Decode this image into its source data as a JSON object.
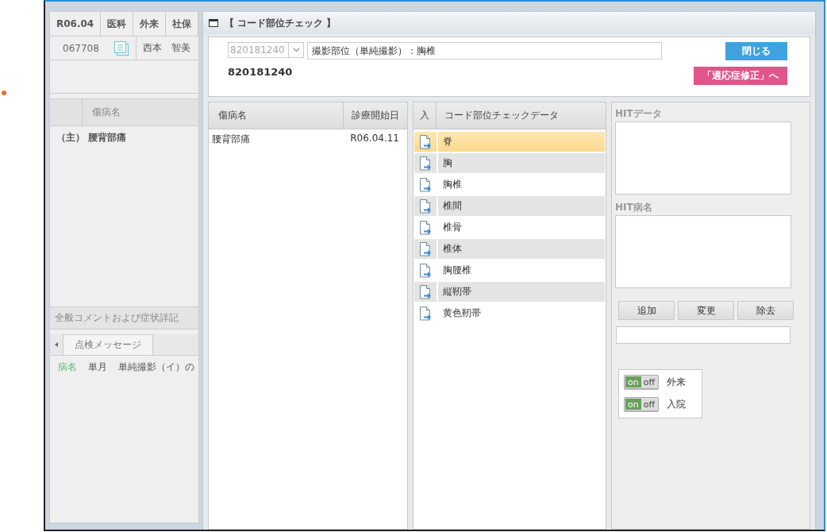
{
  "left_panel": {
    "header_cells": [
      "R06.04",
      "医科",
      "外来",
      "社保"
    ],
    "patient_id": "067708",
    "patient_name": "西本　智美",
    "disease_table": {
      "columns": [
        "傷病名"
      ],
      "rows": [
        {
          "prefix": "（主）",
          "name": "腰背部痛"
        }
      ]
    },
    "comment_bar": "全般コメントおよび症状詳記",
    "message_tabs": [
      {
        "label": "点検メッセージ",
        "selected": true
      }
    ],
    "messages": [
      {
        "category": "病名",
        "period": "単月",
        "text": "単純撮影（イ）の"
      }
    ]
  },
  "dialog": {
    "title": "【 コード部位チェック 】",
    "code_select": {
      "value": "820181240",
      "disabled": true
    },
    "name_field": {
      "value": "撮影部位（単純撮影）：胸椎"
    },
    "code_label": "820181240",
    "close_button": "閉じる",
    "indication_button": "「適応症修正」へ",
    "disease_table": {
      "columns": [
        "傷病名",
        "診療開始日"
      ],
      "rows": [
        {
          "name": "腰背部痛",
          "start_date": "R06.04.11"
        }
      ]
    },
    "code_data": {
      "columns": [
        "入",
        "コード部位チェックデータ"
      ],
      "rows": [
        {
          "label": "脊",
          "selected": true
        },
        {
          "label": "胸",
          "selected": false
        },
        {
          "label": "胸椎",
          "selected": false
        },
        {
          "label": "椎間",
          "selected": false
        },
        {
          "label": "椎骨",
          "selected": false
        },
        {
          "label": "椎体",
          "selected": false
        },
        {
          "label": "胸腰椎",
          "selected": false
        },
        {
          "label": "縦靭帯",
          "selected": false
        },
        {
          "label": "黄色靭帯",
          "selected": false
        }
      ]
    },
    "hit_data": {
      "label": "HITデータ"
    },
    "hit_disease": {
      "label": "HIT病名"
    },
    "action_buttons": [
      "追加",
      "変更",
      "除去"
    ],
    "toggles": [
      {
        "label": "外来",
        "on": true,
        "on_label": "on",
        "off_label": "off"
      },
      {
        "label": "入院",
        "on": true,
        "on_label": "on",
        "off_label": "off"
      }
    ]
  }
}
